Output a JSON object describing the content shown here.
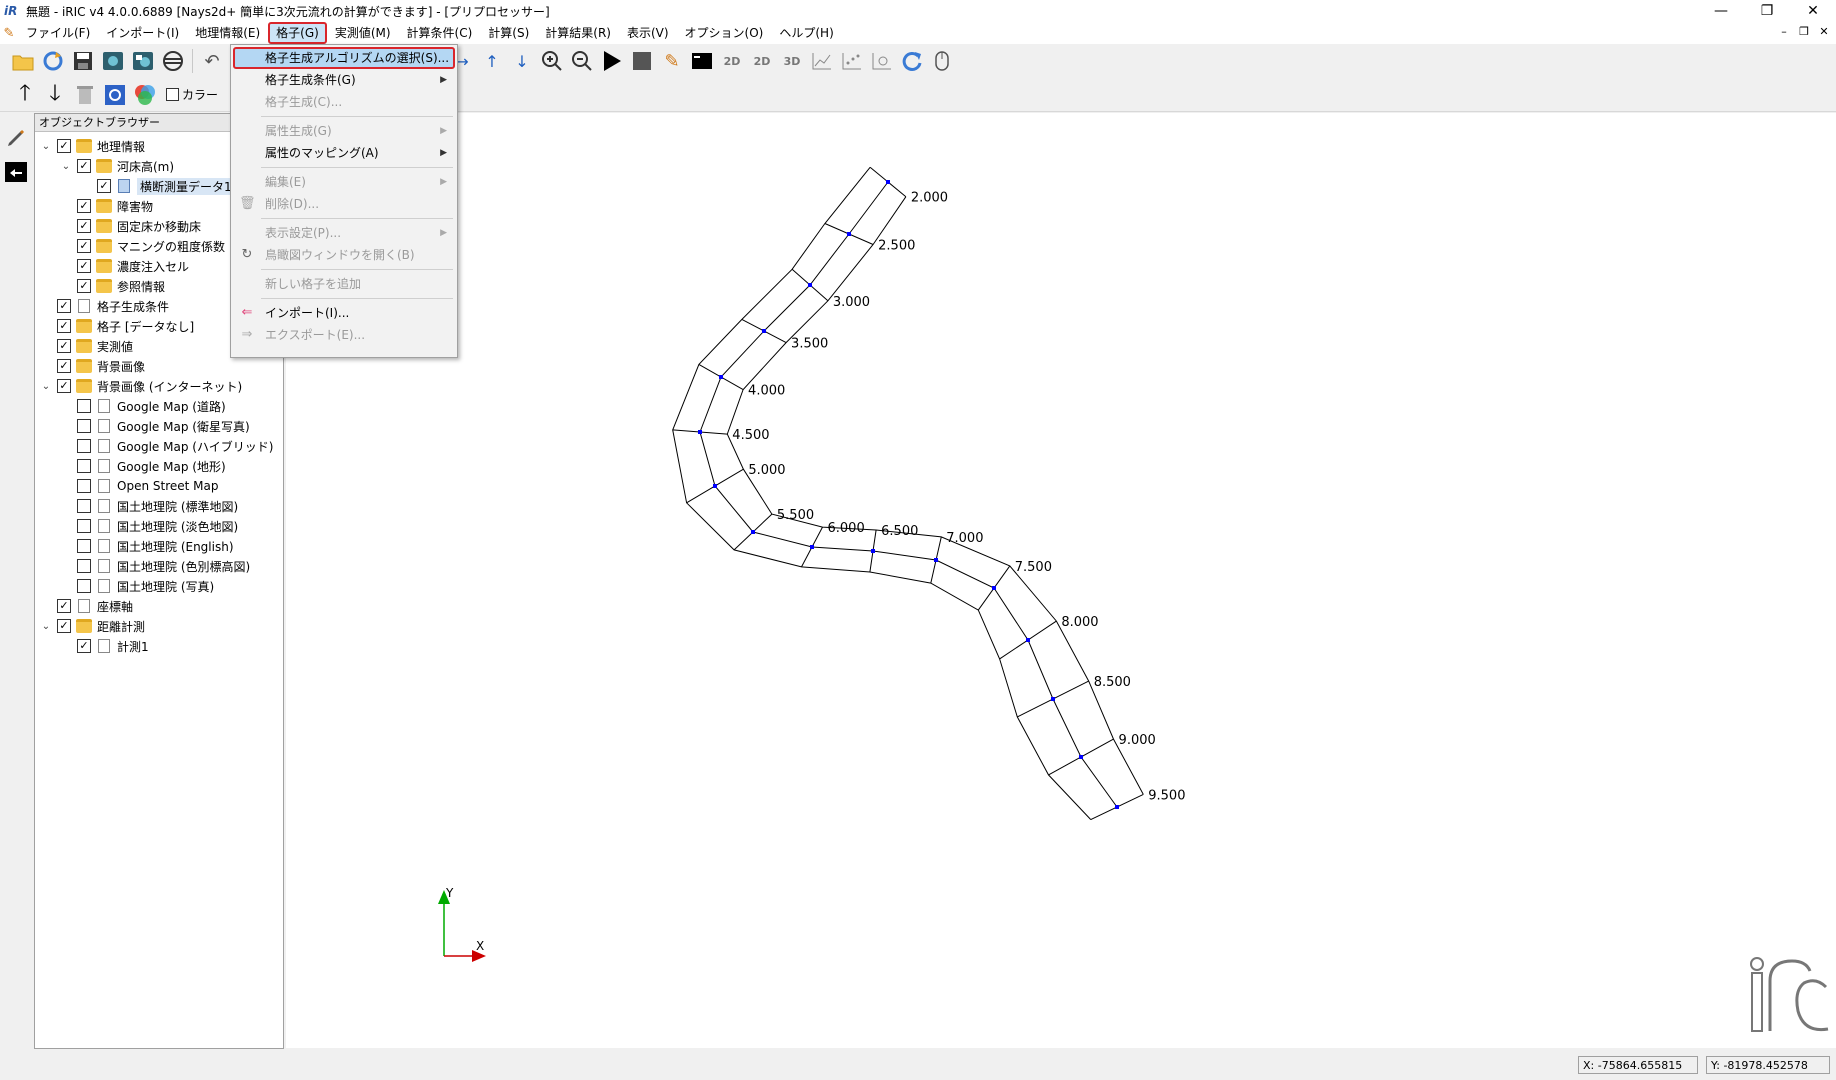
{
  "window": {
    "title": "無題 - iRIC v4 4.0.0.6889 [Nays2d+ 簡単に3次元流れの計算ができます] - [プリプロセッサー]",
    "app_icon": "iR"
  },
  "menubar": [
    {
      "label": "ファイル(F)"
    },
    {
      "label": "インポート(I)"
    },
    {
      "label": "地理情報(E)"
    },
    {
      "label": "格子(G)"
    },
    {
      "label": "実測値(M)"
    },
    {
      "label": "計算条件(C)"
    },
    {
      "label": "計算(S)"
    },
    {
      "label": "計算結果(R)"
    },
    {
      "label": "表示(V)"
    },
    {
      "label": "オプション(O)"
    },
    {
      "label": "ヘルプ(H)"
    }
  ],
  "grid_menu": {
    "items": [
      {
        "label": "格子生成アルゴリズムの選択(S)...",
        "enabled": true,
        "highlighted": true
      },
      {
        "label": "格子生成条件(G)",
        "enabled": true,
        "submenu": true
      },
      {
        "label": "格子生成(C)...",
        "enabled": false
      },
      {
        "label": "属性生成(G)",
        "enabled": false,
        "submenu": true
      },
      {
        "label": "属性のマッピング(A)",
        "enabled": true,
        "submenu": true
      },
      {
        "label": "編集(E)",
        "enabled": false,
        "submenu": true
      },
      {
        "label": "削除(D)...",
        "enabled": false
      },
      {
        "label": "表示設定(P)...",
        "enabled": false,
        "submenu": true
      },
      {
        "label": "鳥瞰図ウィンドウを開く(B)",
        "enabled": false
      },
      {
        "label": "新しい格子を追加",
        "enabled": false
      },
      {
        "label": "インポート(I)...",
        "enabled": true
      },
      {
        "label": "エクスポート(E)...",
        "enabled": false
      }
    ]
  },
  "toolbar2": {
    "color_checkbox_label": "カラー"
  },
  "object_browser": {
    "title": "オブジェクトブラウザー",
    "rows": [
      {
        "label": "地理情報",
        "level": 0,
        "expand": "open",
        "checked": true,
        "icon": "folder"
      },
      {
        "label": "河床高(m)",
        "level": 1,
        "expand": "open",
        "checked": true,
        "icon": "folder"
      },
      {
        "label": "横断測量データ1",
        "level": 2,
        "expand": "",
        "checked": true,
        "icon": "doc-blue",
        "selected": true
      },
      {
        "label": "障害物",
        "level": 1,
        "expand": "",
        "checked": true,
        "icon": "folder"
      },
      {
        "label": "固定床か移動床",
        "level": 1,
        "expand": "",
        "checked": true,
        "icon": "folder"
      },
      {
        "label": "マニングの粗度係数",
        "level": 1,
        "expand": "",
        "checked": true,
        "icon": "folder"
      },
      {
        "label": "濃度注入セル",
        "level": 1,
        "expand": "",
        "checked": true,
        "icon": "folder"
      },
      {
        "label": "参照情報",
        "level": 1,
        "expand": "",
        "checked": true,
        "icon": "folder"
      },
      {
        "label": "格子生成条件",
        "level": 0,
        "expand": "",
        "checked": true,
        "icon": "doc"
      },
      {
        "label": "格子 [データなし]",
        "level": 0,
        "expand": "",
        "checked": true,
        "icon": "folder"
      },
      {
        "label": "実測値",
        "level": 0,
        "expand": "",
        "checked": true,
        "icon": "folder"
      },
      {
        "label": "背景画像",
        "level": 0,
        "expand": "",
        "checked": true,
        "icon": "folder"
      },
      {
        "label": "背景画像 (インターネット)",
        "level": 0,
        "expand": "open",
        "checked": true,
        "icon": "folder"
      },
      {
        "label": "Google Map (道路)",
        "level": 1,
        "expand": "",
        "checked": false,
        "icon": "doc"
      },
      {
        "label": "Google Map (衛星写真)",
        "level": 1,
        "expand": "",
        "checked": false,
        "icon": "doc"
      },
      {
        "label": "Google Map (ハイブリッド)",
        "level": 1,
        "expand": "",
        "checked": false,
        "icon": "doc"
      },
      {
        "label": "Google Map (地形)",
        "level": 1,
        "expand": "",
        "checked": false,
        "icon": "doc"
      },
      {
        "label": "Open Street Map",
        "level": 1,
        "expand": "",
        "checked": false,
        "icon": "doc"
      },
      {
        "label": "国土地理院 (標準地図)",
        "level": 1,
        "expand": "",
        "checked": false,
        "icon": "doc"
      },
      {
        "label": "国土地理院 (淡色地図)",
        "level": 1,
        "expand": "",
        "checked": false,
        "icon": "doc"
      },
      {
        "label": "国土地理院 (English)",
        "level": 1,
        "expand": "",
        "checked": false,
        "icon": "doc"
      },
      {
        "label": "国土地理院 (色別標高図)",
        "level": 1,
        "expand": "",
        "checked": false,
        "icon": "doc"
      },
      {
        "label": "国土地理院 (写真)",
        "level": 1,
        "expand": "",
        "checked": false,
        "icon": "doc"
      },
      {
        "label": "座標軸",
        "level": 0,
        "expand": "",
        "checked": true,
        "icon": "doc"
      },
      {
        "label": "距離計測",
        "level": 0,
        "expand": "open",
        "checked": true,
        "icon": "folder"
      },
      {
        "label": "計測1",
        "level": 1,
        "expand": "",
        "checked": true,
        "icon": "doc"
      }
    ]
  },
  "cross_section_labels": [
    "2.000",
    "2.500",
    "3.000",
    "3.500",
    "4.000",
    "4.500",
    "5.000",
    "5.500",
    "6.000",
    "6.500",
    "7.000",
    "7.500",
    "8.000",
    "8.500",
    "9.000",
    "9.500"
  ],
  "axes": {
    "x_label": "X",
    "y_label": "Y"
  },
  "statusbar": {
    "x": "X: -75864.655815",
    "y": "Y: -81978.452578"
  },
  "colors": {
    "highlight_border": "#d9262c",
    "menu_highlight": "#b4d7f3",
    "node_point": "#0000ff",
    "axis_x": "#cc0000",
    "axis_y": "#00aa00"
  }
}
